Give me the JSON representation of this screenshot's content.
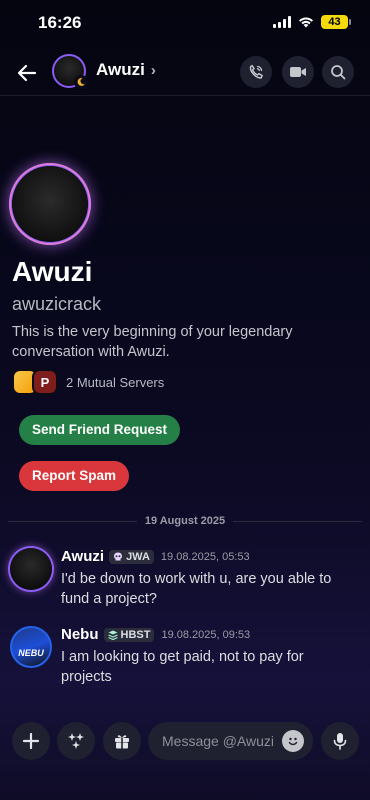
{
  "status_bar": {
    "time": "16:26",
    "battery": "43"
  },
  "header": {
    "name": "Awuzi"
  },
  "profile": {
    "display_name": "Awuzi",
    "username": "awuzicrack",
    "intro": "This is the very beginning of your legendary conversation with Awuzi.",
    "mutual_servers": "2 Mutual Servers"
  },
  "actions": {
    "send_friend_request": "Send Friend Request",
    "report_spam": "Report Spam"
  },
  "date_divider": "19 August 2025",
  "messages": [
    {
      "author": "Awuzi",
      "tag": "JWA",
      "time": "19.08.2025, 05:53",
      "text": "I'd be down to work with u, are you able to fund a project?"
    },
    {
      "author": "Nebu",
      "tag": "HBST",
      "time": "19.08.2025, 09:53",
      "text": "I am looking to get paid, not to pay for projects",
      "avatar_text": "NEBU"
    }
  ],
  "composer": {
    "placeholder": "Message @Awuzi"
  },
  "colors": {
    "accent_purple": "#8b5cf6",
    "green_button": "#248046",
    "red_button": "#da373c",
    "battery_yellow": "#f5d90a"
  }
}
